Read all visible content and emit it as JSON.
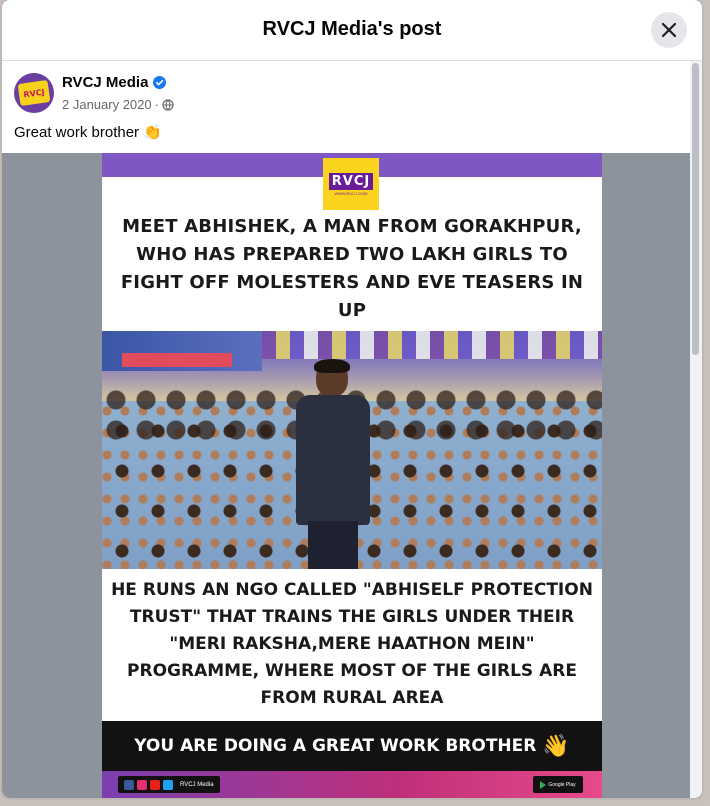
{
  "dialog": {
    "title": "RVCJ Media's post",
    "close_icon": "close-icon"
  },
  "post": {
    "author": "RVCJ Media",
    "verified_icon": "verified-badge-icon",
    "date": "2 January 2020",
    "separator": "·",
    "privacy_icon": "globe-icon",
    "caption": "Great work brother",
    "caption_emoji": "👏"
  },
  "image": {
    "logo": "RVCJ",
    "logo_sub": "WWW.RVCJ.COM",
    "headline": "MEET ABHISHEK, A MAN FROM GORAKHPUR, WHO HAS PREPARED TWO LAKH GIRLS TO FIGHT OFF MOLESTERS AND EVE TEASERS IN UP",
    "body": "HE RUNS AN NGO CALLED \"ABHISELF PROTECTION TRUST\" THAT TRAINS THE GIRLS UNDER THEIR \"MERI RAKSHA,MERE HAATHON MEIN\" PROGRAMME, WHERE MOST OF THE GIRLS ARE FROM RURAL AREA",
    "tagline": "YOU ARE DOING A GREAT WORK BROTHER",
    "tagline_emoji": "👋",
    "footer_handle": "RVCJ Media",
    "store_label": "Google Play"
  },
  "colors": {
    "accent_blue": "#1877f2",
    "purple": "#7e57c2",
    "logo_yellow": "#f9d31d"
  }
}
